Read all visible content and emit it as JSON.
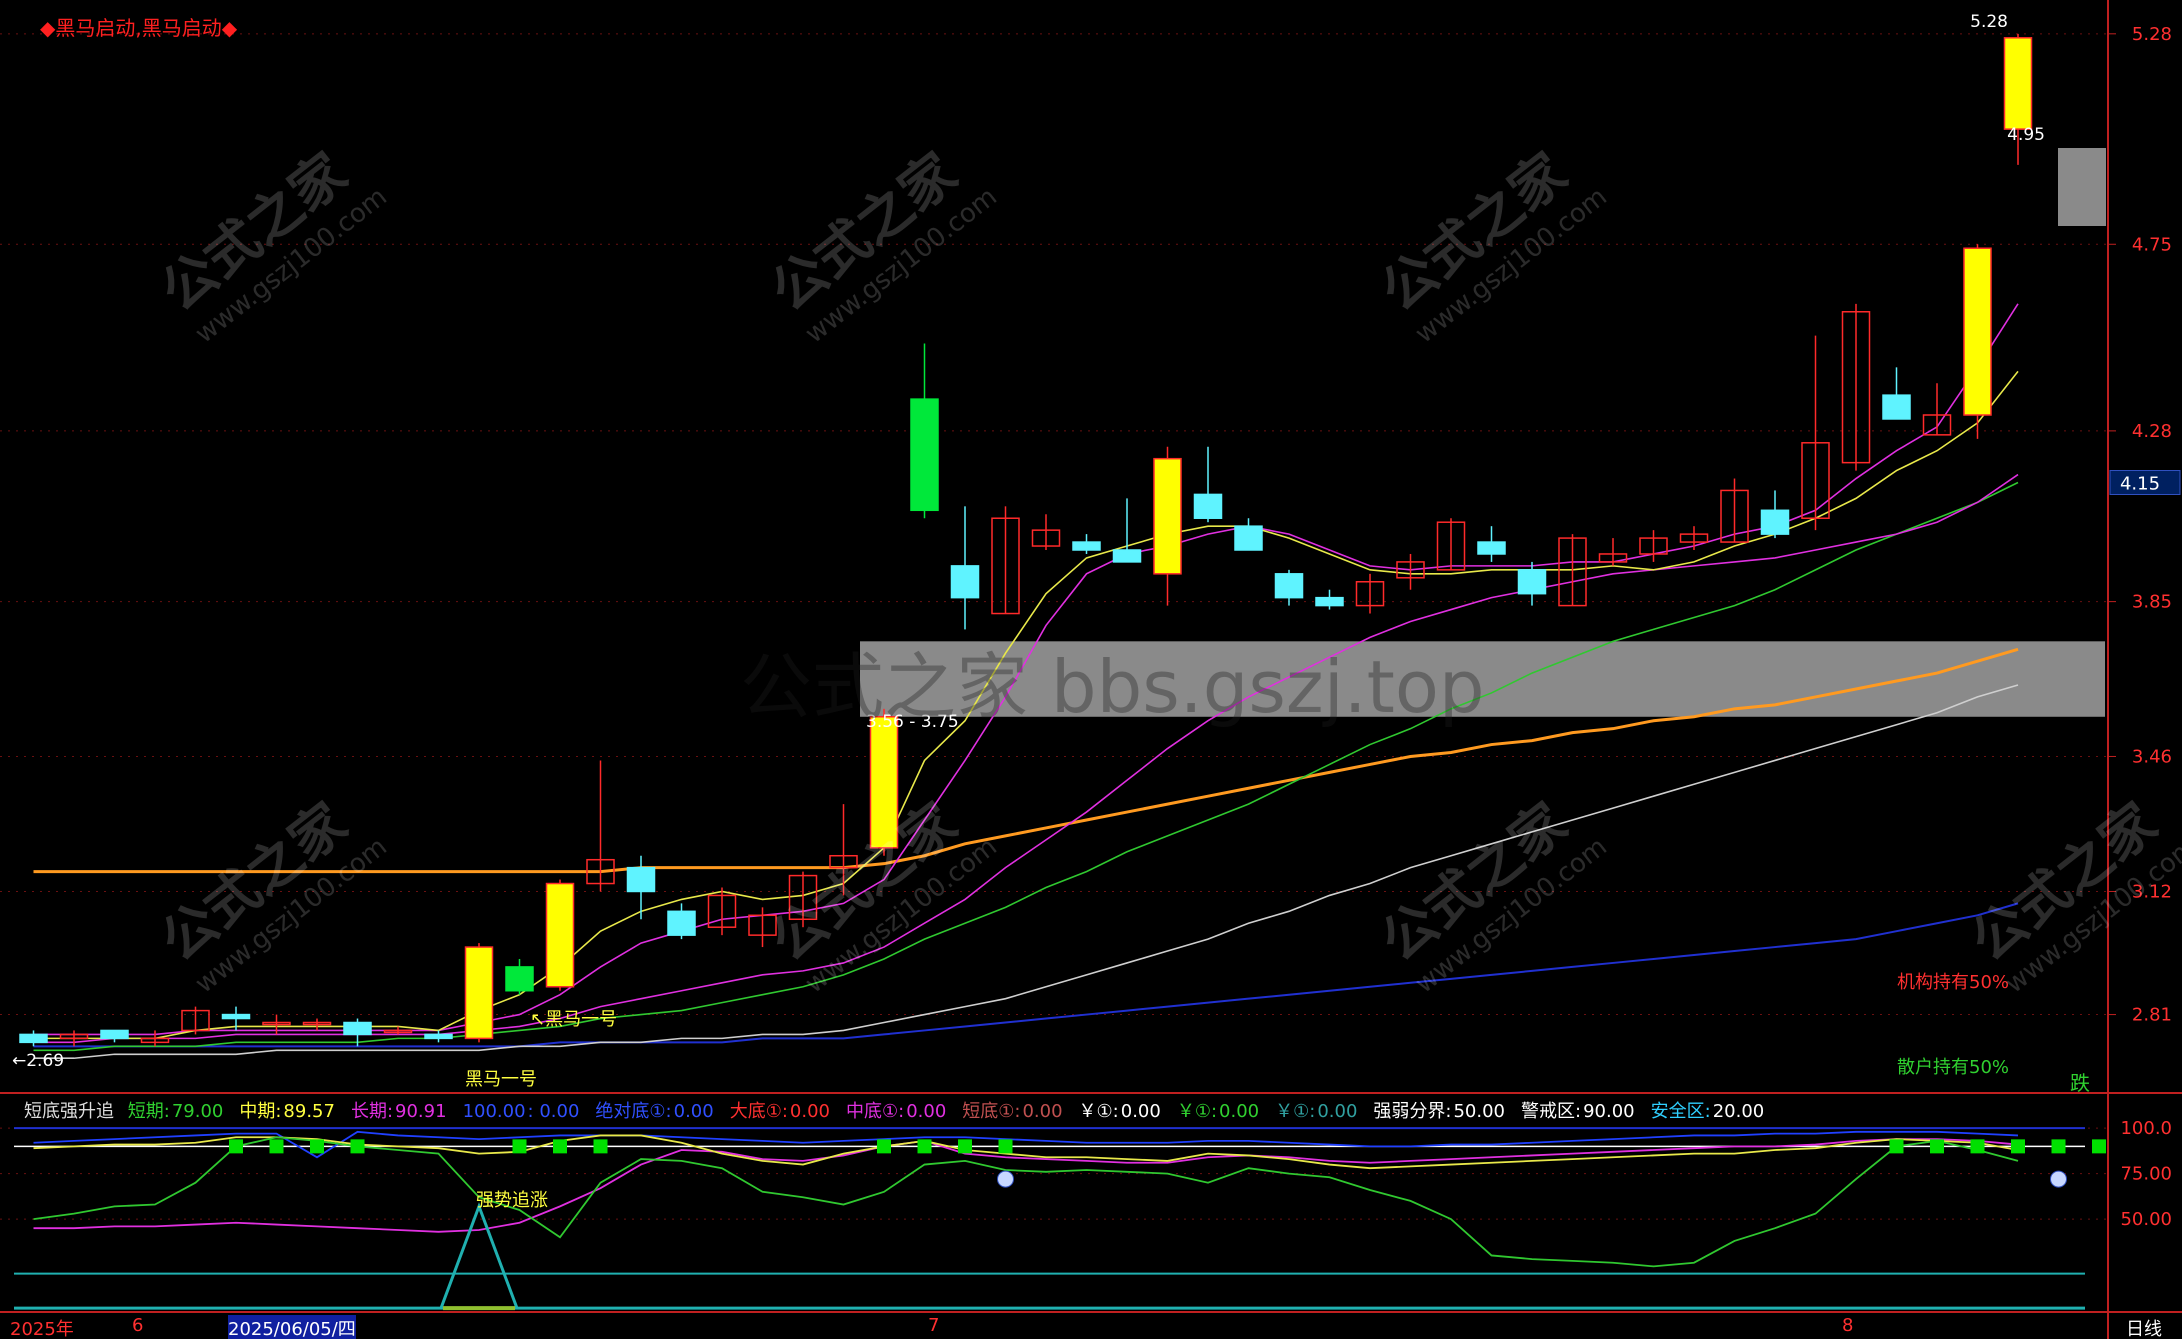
{
  "top_title": "◆黑马启动,黑马启动◆",
  "colors": {
    "up": "#ff2a2a",
    "down_cyan": "#5ff3ff",
    "down_green": "#00e83a",
    "signal": "#ffff00",
    "ma_yellow": "#e8e84a",
    "ma_magenta": "#e030e0",
    "ma_green": "#30c830",
    "ma_white": "#cfcfcf",
    "ma_blue": "#2030d0",
    "ma_orange": "#ff9a20",
    "axis": "#c02020"
  },
  "price_axis": {
    "ticks": [
      "5.28",
      "4.75",
      "4.28",
      "3.85",
      "3.46",
      "3.12",
      "2.81"
    ],
    "current": "4.15"
  },
  "main_annotations": {
    "high_label": "5.28",
    "price_4_95": "4.95",
    "low_label": "←2.69",
    "range_label": "3.56 - 3.75",
    "heima": "↖黑马一号",
    "heima_cut": "黑马一号",
    "jigou": "机构持有50%",
    "sanhu": "散户持有50%",
    "die": "跌"
  },
  "watermark": {
    "cn": "公式之家",
    "url": "www.gszj100.com",
    "band": "公式之家 bbs.gszj.top"
  },
  "indicator": {
    "name": "短底强升追",
    "items": [
      {
        "label": "短期:",
        "value": "79.00",
        "color": "#30d030"
      },
      {
        "label": "中期:",
        "value": "89.57",
        "color": "#ffff40"
      },
      {
        "label": "长期:",
        "value": "90.91",
        "color": "#e030e0"
      },
      {
        "label": "100.00",
        "value": ": 0.00",
        "color": "#3050ff"
      },
      {
        "label": "绝对底①:",
        "value": "0.00",
        "color": "#3050ff"
      },
      {
        "label": "大底①:",
        "value": "0.00",
        "color": "#ff3030"
      },
      {
        "label": "中底①:",
        "value": "0.00",
        "color": "#e030e0"
      },
      {
        "label": "短底①:",
        "value": "0.00",
        "color": "#c05050"
      },
      {
        "label": "￥①:",
        "value": "0.00",
        "color": "#ffffff"
      },
      {
        "label": "￥①:",
        "value": "0.00",
        "color": "#30d030"
      },
      {
        "label": "￥①:",
        "value": "0.00",
        "color": "#30a0a0"
      },
      {
        "label": "强弱分界:",
        "value": "50.00",
        "color": "#ffffff"
      },
      {
        "label": "警戒区:",
        "value": "90.00",
        "color": "#ffffff"
      },
      {
        "label": "安全区:",
        "value": "20.00",
        "color": "#30d0ff"
      }
    ],
    "ticks": [
      "100.0",
      "75.00",
      "50.00"
    ],
    "signal_label": "强势追涨"
  },
  "time_axis": {
    "labels": [
      "2025年",
      "6",
      "2025/06/05/四",
      "7",
      "8"
    ],
    "period": "日线"
  },
  "chart_data": {
    "type": "candlestick",
    "y_range": [
      2.62,
      5.34
    ],
    "candles": [
      {
        "o": 2.76,
        "h": 2.77,
        "l": 2.73,
        "c": 2.74,
        "s": "c"
      },
      {
        "o": 2.75,
        "h": 2.77,
        "l": 2.73,
        "c": 2.76,
        "s": "u"
      },
      {
        "o": 2.77,
        "h": 2.77,
        "l": 2.74,
        "c": 2.75,
        "s": "c"
      },
      {
        "o": 2.74,
        "h": 2.77,
        "l": 2.73,
        "c": 2.75,
        "s": "u"
      },
      {
        "o": 2.77,
        "h": 2.83,
        "l": 2.76,
        "c": 2.82,
        "s": "u"
      },
      {
        "o": 2.81,
        "h": 2.83,
        "l": 2.77,
        "c": 2.8,
        "s": "c"
      },
      {
        "o": 2.79,
        "h": 2.81,
        "l": 2.76,
        "c": 2.79,
        "s": "u"
      },
      {
        "o": 2.79,
        "h": 2.8,
        "l": 2.77,
        "c": 2.79,
        "s": "u"
      },
      {
        "o": 2.79,
        "h": 2.8,
        "l": 2.73,
        "c": 2.76,
        "s": "c"
      },
      {
        "o": 2.77,
        "h": 2.78,
        "l": 2.76,
        "c": 2.77,
        "s": "u"
      },
      {
        "o": 2.76,
        "h": 2.77,
        "l": 2.74,
        "c": 2.75,
        "s": "c"
      },
      {
        "o": 2.75,
        "h": 2.99,
        "l": 2.74,
        "c": 2.98,
        "s": "y"
      },
      {
        "o": 2.93,
        "h": 2.95,
        "l": 2.86,
        "c": 2.87,
        "s": "g"
      },
      {
        "o": 2.88,
        "h": 3.15,
        "l": 2.87,
        "c": 3.14,
        "s": "y"
      },
      {
        "o": 3.14,
        "h": 3.45,
        "l": 3.12,
        "c": 3.2,
        "s": "u"
      },
      {
        "o": 3.18,
        "h": 3.21,
        "l": 3.05,
        "c": 3.12,
        "s": "c"
      },
      {
        "o": 3.07,
        "h": 3.09,
        "l": 3.0,
        "c": 3.01,
        "s": "c"
      },
      {
        "o": 3.03,
        "h": 3.13,
        "l": 3.01,
        "c": 3.11,
        "s": "u"
      },
      {
        "o": 3.01,
        "h": 3.08,
        "l": 2.98,
        "c": 3.06,
        "s": "u"
      },
      {
        "o": 3.05,
        "h": 3.17,
        "l": 3.03,
        "c": 3.16,
        "s": "u"
      },
      {
        "o": 3.18,
        "h": 3.34,
        "l": 3.11,
        "c": 3.21,
        "s": "u"
      },
      {
        "o": 3.23,
        "h": 3.58,
        "l": 3.21,
        "c": 3.56,
        "s": "y"
      },
      {
        "o": 4.08,
        "h": 4.5,
        "l": 4.06,
        "c": 4.36,
        "s": "g"
      },
      {
        "o": 3.94,
        "h": 4.09,
        "l": 3.78,
        "c": 3.86,
        "s": "c"
      },
      {
        "o": 3.82,
        "h": 4.09,
        "l": 3.82,
        "c": 4.06,
        "s": "u"
      },
      {
        "o": 3.99,
        "h": 4.07,
        "l": 3.98,
        "c": 4.03,
        "s": "u"
      },
      {
        "o": 4.0,
        "h": 4.02,
        "l": 3.97,
        "c": 3.98,
        "s": "c"
      },
      {
        "o": 3.98,
        "h": 4.11,
        "l": 3.95,
        "c": 3.95,
        "s": "c"
      },
      {
        "o": 3.92,
        "h": 4.24,
        "l": 3.84,
        "c": 4.21,
        "s": "y"
      },
      {
        "o": 4.12,
        "h": 4.24,
        "l": 4.05,
        "c": 4.06,
        "s": "c"
      },
      {
        "o": 4.04,
        "h": 4.06,
        "l": 3.98,
        "c": 3.98,
        "s": "c"
      },
      {
        "o": 3.92,
        "h": 3.93,
        "l": 3.84,
        "c": 3.86,
        "s": "c"
      },
      {
        "o": 3.86,
        "h": 3.88,
        "l": 3.83,
        "c": 3.84,
        "s": "c"
      },
      {
        "o": 3.84,
        "h": 3.92,
        "l": 3.82,
        "c": 3.9,
        "s": "u"
      },
      {
        "o": 3.91,
        "h": 3.97,
        "l": 3.88,
        "c": 3.95,
        "s": "u"
      },
      {
        "o": 3.93,
        "h": 4.06,
        "l": 3.93,
        "c": 4.05,
        "s": "u"
      },
      {
        "o": 4.0,
        "h": 4.04,
        "l": 3.95,
        "c": 3.97,
        "s": "c"
      },
      {
        "o": 3.93,
        "h": 3.95,
        "l": 3.84,
        "c": 3.87,
        "s": "c"
      },
      {
        "o": 3.84,
        "h": 4.02,
        "l": 3.84,
        "c": 4.01,
        "s": "u"
      },
      {
        "o": 3.95,
        "h": 4.01,
        "l": 3.94,
        "c": 3.97,
        "s": "u"
      },
      {
        "o": 3.97,
        "h": 4.03,
        "l": 3.95,
        "c": 4.01,
        "s": "u"
      },
      {
        "o": 4.0,
        "h": 4.04,
        "l": 3.98,
        "c": 4.02,
        "s": "u"
      },
      {
        "o": 4.0,
        "h": 4.16,
        "l": 4.0,
        "c": 4.13,
        "s": "u"
      },
      {
        "o": 4.08,
        "h": 4.13,
        "l": 4.01,
        "c": 4.02,
        "s": "c"
      },
      {
        "o": 4.06,
        "h": 4.52,
        "l": 4.03,
        "c": 4.25,
        "s": "u"
      },
      {
        "o": 4.2,
        "h": 4.6,
        "l": 4.18,
        "c": 4.58,
        "s": "u"
      },
      {
        "o": 4.37,
        "h": 4.44,
        "l": 4.31,
        "c": 4.31,
        "s": "c"
      },
      {
        "o": 4.27,
        "h": 4.4,
        "l": 4.27,
        "c": 4.32,
        "s": "u"
      },
      {
        "o": 4.32,
        "h": 4.75,
        "l": 4.26,
        "c": 4.74,
        "s": "y"
      },
      {
        "o": 5.04,
        "h": 5.28,
        "l": 4.95,
        "c": 5.27,
        "s": "y"
      }
    ],
    "ma_yellow": [
      2.75,
      2.75,
      2.75,
      2.75,
      2.77,
      2.78,
      2.78,
      2.78,
      2.78,
      2.78,
      2.77,
      2.82,
      2.86,
      2.93,
      3.02,
      3.07,
      3.1,
      3.12,
      3.1,
      3.11,
      3.14,
      3.23,
      3.45,
      3.55,
      3.72,
      3.87,
      3.96,
      3.99,
      4.02,
      4.04,
      4.04,
      4.01,
      3.97,
      3.93,
      3.92,
      3.92,
      3.93,
      3.93,
      3.93,
      3.94,
      3.93,
      3.95,
      3.99,
      4.02,
      4.06,
      4.11,
      4.18,
      4.23,
      4.3,
      4.43
    ],
    "ma_magenta": [
      2.76,
      2.76,
      2.76,
      2.76,
      2.77,
      2.77,
      2.77,
      2.77,
      2.77,
      2.77,
      2.77,
      2.79,
      2.81,
      2.86,
      2.93,
      2.99,
      3.02,
      3.05,
      3.06,
      3.07,
      3.09,
      3.15,
      3.3,
      3.45,
      3.61,
      3.79,
      3.92,
      3.97,
      3.99,
      4.02,
      4.04,
      4.02,
      3.98,
      3.94,
      3.93,
      3.94,
      3.94,
      3.94,
      3.95,
      3.95,
      3.97,
      3.99,
      4.02,
      4.04,
      4.08,
      4.16,
      4.23,
      4.29,
      4.44,
      4.6
    ],
    "ma_magenta2": [
      2.74,
      2.74,
      2.75,
      2.75,
      2.75,
      2.76,
      2.76,
      2.76,
      2.76,
      2.76,
      2.76,
      2.77,
      2.78,
      2.8,
      2.83,
      2.85,
      2.87,
      2.89,
      2.91,
      2.92,
      2.94,
      2.98,
      3.04,
      3.1,
      3.18,
      3.25,
      3.32,
      3.4,
      3.48,
      3.55,
      3.61,
      3.66,
      3.71,
      3.76,
      3.8,
      3.83,
      3.86,
      3.88,
      3.9,
      3.92,
      3.93,
      3.94,
      3.95,
      3.96,
      3.98,
      4.0,
      4.02,
      4.05,
      4.1,
      4.17
    ],
    "ma_green": [
      2.72,
      2.72,
      2.73,
      2.73,
      2.73,
      2.74,
      2.74,
      2.74,
      2.74,
      2.75,
      2.75,
      2.76,
      2.77,
      2.78,
      2.8,
      2.81,
      2.82,
      2.84,
      2.86,
      2.88,
      2.91,
      2.95,
      3.0,
      3.04,
      3.08,
      3.13,
      3.17,
      3.22,
      3.26,
      3.3,
      3.34,
      3.39,
      3.44,
      3.49,
      3.53,
      3.58,
      3.62,
      3.67,
      3.71,
      3.75,
      3.78,
      3.81,
      3.84,
      3.88,
      3.93,
      3.98,
      4.02,
      4.06,
      4.1,
      4.15
    ],
    "ma_white": [
      2.7,
      2.7,
      2.71,
      2.71,
      2.71,
      2.71,
      2.72,
      2.72,
      2.72,
      2.72,
      2.72,
      2.72,
      2.73,
      2.73,
      2.74,
      2.74,
      2.75,
      2.75,
      2.76,
      2.76,
      2.77,
      2.79,
      2.81,
      2.83,
      2.85,
      2.88,
      2.91,
      2.94,
      2.97,
      3.0,
      3.04,
      3.07,
      3.11,
      3.14,
      3.18,
      3.21,
      3.24,
      3.27,
      3.3,
      3.33,
      3.36,
      3.39,
      3.42,
      3.45,
      3.48,
      3.51,
      3.54,
      3.57,
      3.61,
      3.64
    ],
    "ma_blue": [
      2.73,
      2.73,
      2.73,
      2.73,
      2.73,
      2.73,
      2.73,
      2.73,
      2.73,
      2.73,
      2.73,
      2.73,
      2.73,
      2.74,
      2.74,
      2.74,
      2.74,
      2.74,
      2.75,
      2.75,
      2.75,
      2.76,
      2.77,
      2.78,
      2.79,
      2.8,
      2.81,
      2.82,
      2.83,
      2.84,
      2.85,
      2.86,
      2.87,
      2.88,
      2.89,
      2.9,
      2.91,
      2.92,
      2.93,
      2.94,
      2.95,
      2.96,
      2.97,
      2.98,
      2.99,
      3.0,
      3.02,
      3.04,
      3.06,
      3.09
    ],
    "ma_orange": [
      3.17,
      3.17,
      3.17,
      3.17,
      3.17,
      3.17,
      3.17,
      3.17,
      3.17,
      3.17,
      3.17,
      3.17,
      3.17,
      3.17,
      3.17,
      3.18,
      3.18,
      3.18,
      3.18,
      3.18,
      3.18,
      3.19,
      3.21,
      3.24,
      3.26,
      3.28,
      3.3,
      3.32,
      3.34,
      3.36,
      3.38,
      3.4,
      3.42,
      3.44,
      3.46,
      3.47,
      3.49,
      3.5,
      3.52,
      3.53,
      3.55,
      3.56,
      3.58,
      3.59,
      3.61,
      3.63,
      3.65,
      3.67,
      3.7,
      3.73
    ]
  },
  "indicator_data": {
    "y_range": [
      0,
      110
    ],
    "short": [
      50,
      53,
      57,
      58,
      70,
      90,
      95,
      93,
      90,
      88,
      86,
      62,
      55,
      40,
      70,
      83,
      82,
      78,
      65,
      62,
      58,
      65,
      80,
      82,
      77,
      76,
      77,
      76,
      75,
      70,
      78,
      75,
      73,
      66,
      60,
      50,
      30,
      28,
      27,
      26,
      24,
      26,
      38,
      45,
      53,
      72,
      90,
      93,
      88,
      82
    ],
    "mid": [
      89,
      90,
      91,
      91,
      92,
      95,
      95,
      94,
      91,
      90,
      89,
      86,
      87,
      93,
      96,
      96,
      92,
      86,
      82,
      80,
      86,
      90,
      93,
      88,
      86,
      84,
      84,
      83,
      82,
      86,
      85,
      83,
      80,
      78,
      79,
      80,
      81,
      82,
      83,
      84,
      85,
      86,
      86,
      88,
      89,
      92,
      94,
      93,
      92,
      88
    ],
    "long": [
      45,
      45,
      46,
      46,
      47,
      48,
      47,
      46,
      45,
      44,
      43,
      44,
      48,
      57,
      67,
      80,
      88,
      87,
      83,
      82,
      85,
      90,
      93,
      86,
      84,
      83,
      82,
      81,
      81,
      84,
      85,
      84,
      82,
      81,
      82,
      83,
      84,
      85,
      86,
      87,
      88,
      89,
      90,
      90,
      91,
      93,
      94,
      94,
      93,
      91
    ],
    "blue": [
      92,
      93,
      94,
      95,
      96,
      97,
      97,
      84,
      98,
      96,
      95,
      94,
      95,
      96,
      96,
      96,
      95,
      94,
      93,
      92,
      93,
      94,
      95,
      95,
      94,
      93,
      92,
      92,
      92,
      93,
      93,
      92,
      91,
      90,
      90,
      91,
      91,
      92,
      93,
      94,
      95,
      96,
      96,
      97,
      97,
      98,
      98,
      98,
      97,
      96
    ],
    "green_marks": [
      5,
      6,
      7,
      8,
      12,
      13,
      14,
      21,
      22,
      23,
      24,
      46,
      47,
      48,
      49,
      50,
      51
    ],
    "signal_peak": 11
  }
}
